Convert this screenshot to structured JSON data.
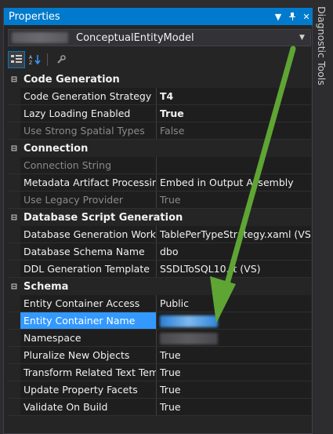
{
  "window": {
    "title": "Properties"
  },
  "side_tab": {
    "label": "Diagnostic Tools"
  },
  "object_selector": {
    "value": "ConceptualEntityModel"
  },
  "colors": {
    "accent": "#007acc",
    "selection": "#3399ff",
    "arrow": "#5ea534"
  },
  "icons": {
    "categorized": "categorized-icon",
    "alphabetical": "alphabetical-sort-icon",
    "property_pages": "wrench-icon",
    "dropdown": "dropdown-arrow-icon",
    "pin": "pin-icon",
    "close": "close-icon"
  },
  "categories": [
    {
      "label": "Code Generation",
      "rows": [
        {
          "name": "Code Generation Strategy",
          "value": "T4",
          "bold": true
        },
        {
          "name": "Lazy Loading Enabled",
          "value": "True",
          "bold": true
        },
        {
          "name": "Use Strong Spatial Types",
          "value": "False",
          "dim": true
        }
      ]
    },
    {
      "label": "Connection",
      "rows": [
        {
          "name": "Connection String",
          "value": "",
          "dim": true
        },
        {
          "name": "Metadata Artifact Processing",
          "value": "Embed in Output Assembly"
        },
        {
          "name": "Use Legacy Provider",
          "value": "True",
          "dim": true
        }
      ]
    },
    {
      "label": "Database Script Generation",
      "rows": [
        {
          "name": "Database Generation Workflow",
          "value": "TablePerTypeStrategy.xaml (VS)"
        },
        {
          "name": "Database Schema Name",
          "value": "dbo"
        },
        {
          "name": "DDL Generation Template",
          "value": "SSDLToSQL10.tt (VS)"
        }
      ]
    },
    {
      "label": "Schema",
      "rows": [
        {
          "name": "Entity Container Access",
          "value": "Public"
        },
        {
          "name": "Entity Container Name",
          "value": "",
          "selected": true,
          "blur": "blue"
        },
        {
          "name": "Namespace",
          "value": "",
          "blur": "grey"
        },
        {
          "name": "Pluralize New Objects",
          "value": "True"
        },
        {
          "name": "Transform Related Text Templates On Save",
          "value": "True"
        },
        {
          "name": "Update Property Facets",
          "value": "True"
        },
        {
          "name": "Validate On Build",
          "value": "True"
        }
      ]
    }
  ]
}
